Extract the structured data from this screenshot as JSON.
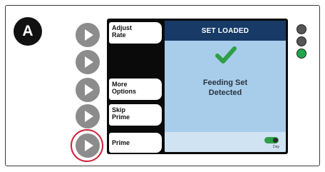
{
  "figure_label": "A",
  "softkeys": [
    {
      "line1": "Adjust",
      "line2": "Rate"
    },
    {
      "line1": "More",
      "line2": "Options"
    },
    {
      "line1": "Skip",
      "line2": "Prime"
    },
    {
      "line1": "Prime",
      "line2": ""
    }
  ],
  "panel": {
    "header": "SET LOADED",
    "status_line1": "Feeding Set",
    "status_line2": "Detected",
    "toggle_label": "Day"
  },
  "colors": {
    "header_bg": "#173a66",
    "panel_bg": "#a7cdea",
    "check": "#2f9e47",
    "highlight_ring": "#d0213a",
    "led_off": "#555555",
    "led_on": "#1fa64a"
  },
  "icons": {
    "side_button": "play-triangle-icon",
    "status": "checkmark-icon"
  },
  "indicators": [
    "off",
    "off",
    "on"
  ],
  "highlighted_button": "Prime"
}
